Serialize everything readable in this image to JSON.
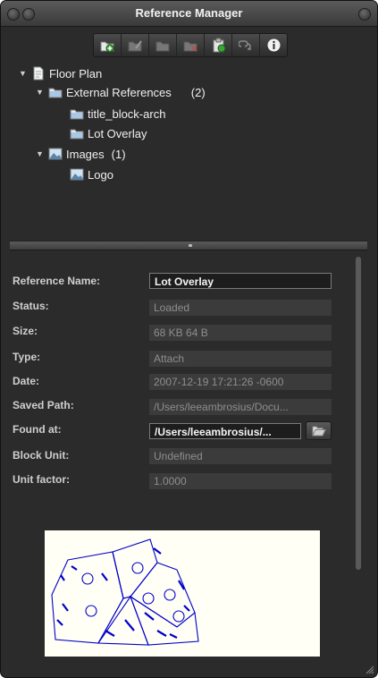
{
  "window": {
    "title": "Reference Manager"
  },
  "toolbar": {
    "buttons": [
      {
        "icon": "attach-icon"
      },
      {
        "icon": "edit-icon"
      },
      {
        "icon": "open-icon"
      },
      {
        "icon": "detach-icon"
      },
      {
        "icon": "reload-icon"
      },
      {
        "icon": "unload-icon"
      },
      {
        "icon": "info-icon"
      }
    ]
  },
  "tree": {
    "root": {
      "label": "Floor Plan"
    },
    "external_refs": {
      "label": "External References",
      "count": "(2)"
    },
    "xref1": {
      "label": "title_block-arch"
    },
    "xref2": {
      "label": "Lot Overlay"
    },
    "images": {
      "label": "Images",
      "count": "(1)"
    },
    "image1": {
      "label": "Logo"
    }
  },
  "properties": {
    "reference_name": {
      "label": "Reference Name:",
      "value": "Lot Overlay"
    },
    "status": {
      "label": "Status:",
      "value": "Loaded"
    },
    "size": {
      "label": "Size:",
      "value": "68 KB 64 B"
    },
    "type": {
      "label": "Type:",
      "value": "Attach"
    },
    "date": {
      "label": "Date:",
      "value": "2007-12-19 17:21:26 -0600"
    },
    "saved_path": {
      "label": "Saved Path:",
      "value": "/Users/leeambrosius/Docu..."
    },
    "found_at": {
      "label": "Found at:",
      "value": "/Users/leeambrosius/..."
    },
    "block_unit": {
      "label": "Block Unit:",
      "value": "Undefined"
    },
    "unit_factor": {
      "label": "Unit factor:",
      "value": "1.0000"
    }
  },
  "colors": {
    "window_bg": "#2b2b2b",
    "preview_line": "#0000cc"
  }
}
